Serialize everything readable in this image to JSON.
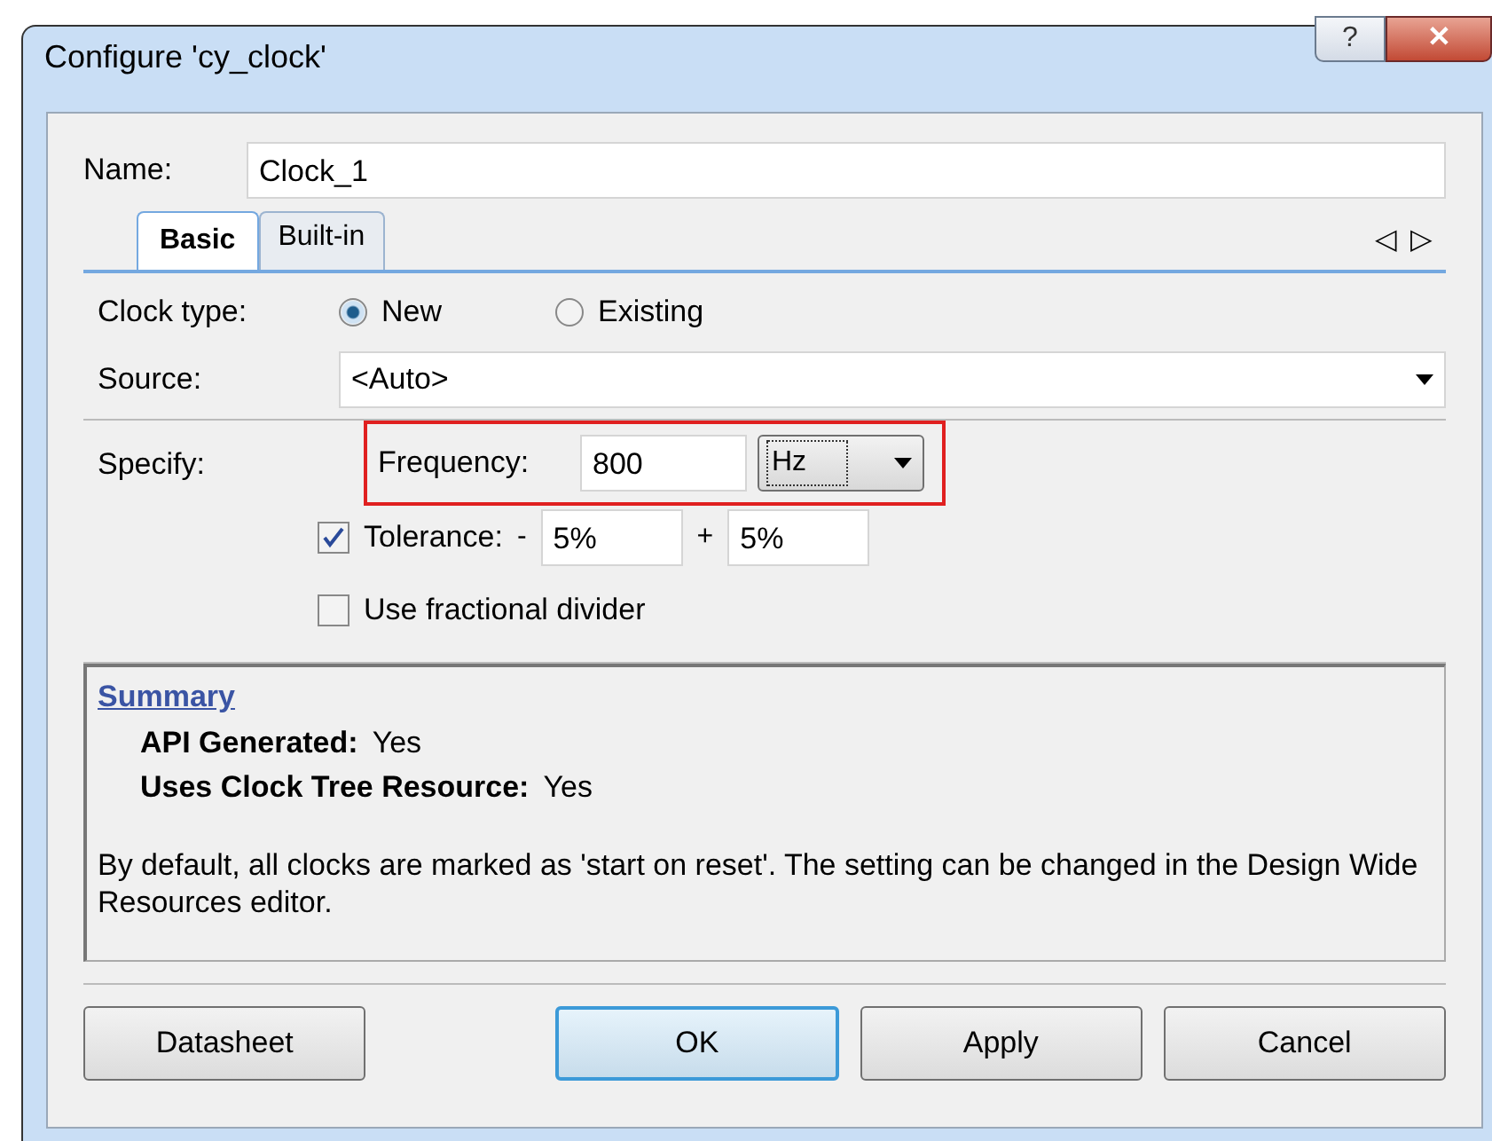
{
  "window": {
    "title": "Configure 'cy_clock'",
    "help_button": "?",
    "close_button": "✕"
  },
  "name": {
    "label": "Name:",
    "value": "Clock_1"
  },
  "tabs": [
    {
      "label": "Basic",
      "selected": true
    },
    {
      "label": "Built-in",
      "selected": false
    }
  ],
  "tab_scroll": [
    "◁",
    "▷"
  ],
  "clock_type": {
    "label": "Clock type:",
    "options": [
      {
        "label": "New",
        "selected": true
      },
      {
        "label": "Existing",
        "selected": false
      }
    ]
  },
  "source": {
    "label": "Source:",
    "value": "<Auto>"
  },
  "specify": {
    "label": "Specify:",
    "frequency": {
      "label": "Frequency:",
      "value": "800",
      "unit": "Hz",
      "highlighted": true
    },
    "tolerance": {
      "label": "Tolerance:",
      "checked": true,
      "minus_sign": "-",
      "minus_value": "5%",
      "plus_sign": "+",
      "plus_value": "5%"
    },
    "fractional_divider": {
      "label": "Use fractional divider",
      "checked": false
    }
  },
  "summary": {
    "title": "Summary",
    "items": [
      {
        "label": "API Generated:",
        "value": "Yes"
      },
      {
        "label": "Uses Clock Tree Resource:",
        "value": "Yes"
      }
    ],
    "note": "By default, all clocks are marked as 'start on reset'. The setting can be changed in the Design Wide Resources editor."
  },
  "buttons": [
    {
      "label": "Datasheet",
      "focused": false
    },
    {
      "label": "OK",
      "focused": true
    },
    {
      "label": "Apply",
      "focused": false
    },
    {
      "label": "Cancel",
      "focused": false
    }
  ]
}
